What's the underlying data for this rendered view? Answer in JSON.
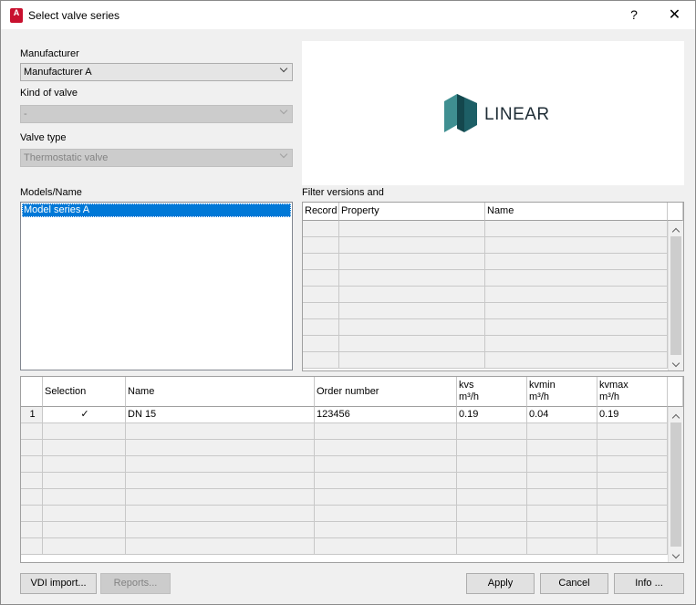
{
  "window": {
    "title": "Select valve series",
    "help_glyph": "?",
    "close_glyph": "✕",
    "app_icon_letter": "A"
  },
  "manufacturer": {
    "label": "Manufacturer",
    "value": "Manufacturer A"
  },
  "kind_of_valve": {
    "label": "Kind of valve",
    "value": "-"
  },
  "valve_type": {
    "label": "Valve type",
    "value": "Thermostatic valve"
  },
  "logo": {
    "text": "LINEAR"
  },
  "models": {
    "label": "Models/Name",
    "items": [
      "Model series A"
    ]
  },
  "filter": {
    "label": "Filter versions and",
    "columns": [
      "Record",
      "Property",
      "Name"
    ]
  },
  "versions": {
    "columns": [
      {
        "label": "Selection",
        "unit": ""
      },
      {
        "label": "Name",
        "unit": ""
      },
      {
        "label": "Order number",
        "unit": ""
      },
      {
        "label": "kvs",
        "unit": "m³/h"
      },
      {
        "label": "kvmin",
        "unit": "m³/h"
      },
      {
        "label": "kvmax",
        "unit": "m³/h"
      }
    ],
    "rows": [
      {
        "index": "1",
        "selection": "✓",
        "name": "DN 15",
        "order_number": "123456",
        "kvs": "0.19",
        "kvmin": "0.04",
        "kvmax": "0.19"
      }
    ]
  },
  "buttons": {
    "vdi_import": "VDI import...",
    "reports": "Reports...",
    "apply": "Apply",
    "cancel": "Cancel",
    "info": "Info ..."
  },
  "colors": {
    "selection": "#0078d7",
    "logo_teal": "#1d6f73"
  }
}
